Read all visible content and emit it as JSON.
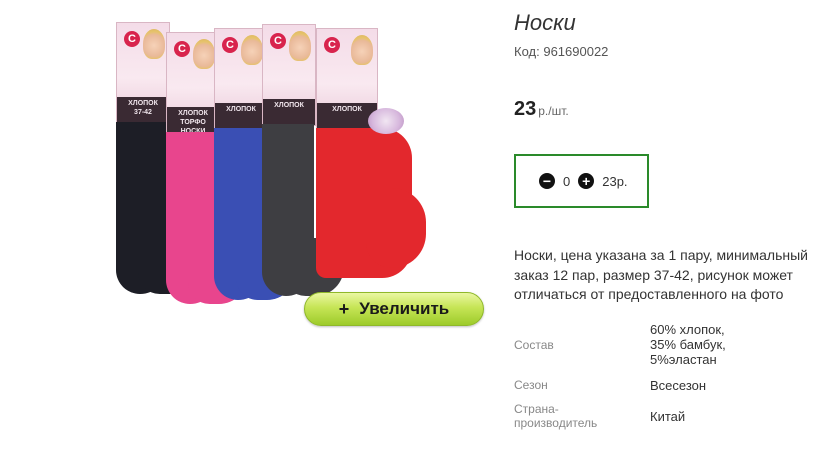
{
  "product": {
    "title": "Носки",
    "code_label": "Код:",
    "code": "961690022",
    "price": "23",
    "price_unit": "р./шт."
  },
  "quantity": {
    "value": "0",
    "sum": "23р."
  },
  "image": {
    "card_text": "ХЛОПОК",
    "card_subtext": "ТОРФО НОСКИ",
    "card_size": "37-42",
    "colors": [
      "#1d1e26",
      "#e8458d",
      "#3a4fb4",
      "#3e3e42",
      "#e3282d"
    ]
  },
  "zoom_label": "Увеличить",
  "description": "Носки, цена указана за 1 пару, минимальный заказ 12 пар, размер 37-42, рисунок может отличаться от предоставленного на фото",
  "properties": [
    {
      "name": "Состав",
      "value": "60% хлопок, 35% бамбук, 5%эластан"
    },
    {
      "name": "Сезон",
      "value": "Всесезон"
    },
    {
      "name": "Страна-производитель",
      "value": "Китай"
    }
  ]
}
